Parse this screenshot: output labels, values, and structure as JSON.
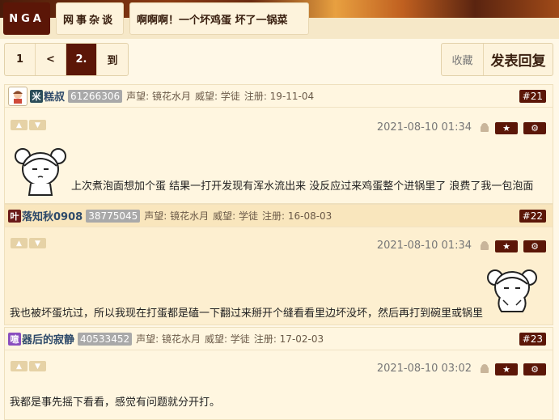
{
  "header": {
    "logo": "NGA",
    "forum": "网事杂谈",
    "thread_title": "啊啊啊！一个坏鸡蛋 坏了一锅菜"
  },
  "pager": {
    "pages": [
      "1",
      "<",
      "2.",
      "到"
    ],
    "active_index": 2
  },
  "actions": {
    "favorite": "收藏",
    "reply": "发表回复"
  },
  "posts": [
    {
      "badge": "米",
      "badge_color": "#2b4d5a",
      "username": "糕叔",
      "uid": "61266306",
      "meta": [
        "声望: 镜花水月",
        "威望: 学徒",
        "注册: 19-11-04"
      ],
      "floor": "#21",
      "datetime": "2021-08-10 01:34",
      "content": "上次煮泡面想加个蛋 结果一打开发现有浑水流出来 没反应过来鸡蛋整个进锅里了 浪费了我一包泡面"
    },
    {
      "badge": "叶",
      "badge_color": "#6a1a1a",
      "username": "落知秋0908",
      "uid": "38775045",
      "meta": [
        "声望: 镜花水月",
        "威望: 学徒",
        "注册: 16-08-03"
      ],
      "floor": "#22",
      "datetime": "2021-08-10 01:34",
      "content": "我也被坏蛋坑过，所以我现在打蛋都是磕一下翻过来掰开个缝看看里边坏没坏，然后再打到碗里或锅里"
    },
    {
      "badge": "噫",
      "badge_color": "#8a4fbf",
      "username": "器后的寂静",
      "uid": "40533452",
      "meta": [
        "声望: 镜花水月",
        "威望: 学徒",
        "注册: 17-02-03"
      ],
      "floor": "#23",
      "datetime": "2021-08-10 03:02",
      "content": "我都是事先摇下看看，感觉有问题就分开打。"
    }
  ],
  "icons": {
    "thumb_up": "thumbs-up-icon",
    "thumb_down": "thumbs-down-icon",
    "android": "android-icon",
    "star": "star-icon",
    "gear": "gear-icon"
  },
  "colors": {
    "accent": "#5b1607",
    "background": "#fff8e7"
  }
}
